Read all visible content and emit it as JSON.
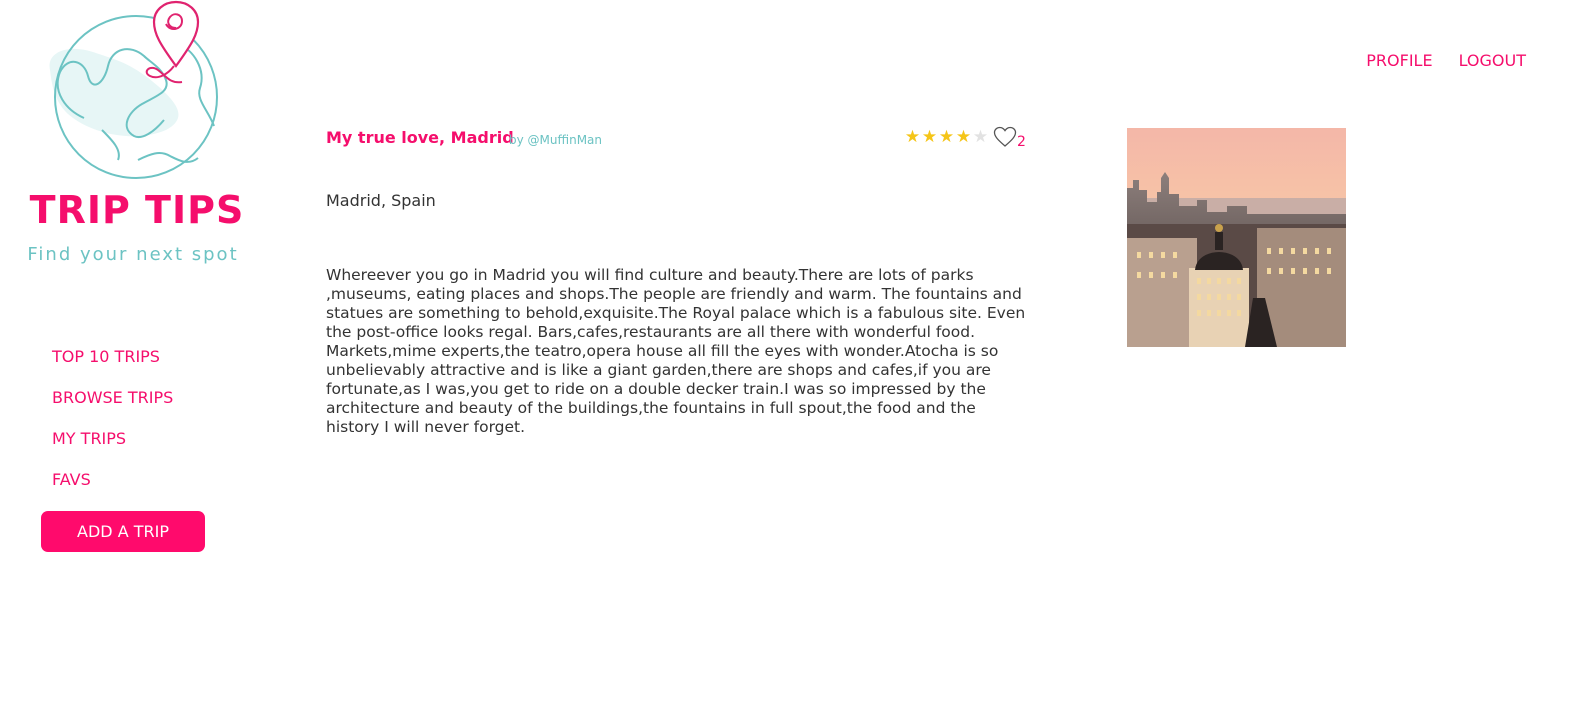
{
  "brand": {
    "name": "TRIP TIPS",
    "tagline": "Find your next spot",
    "logo_icon": "globe-with-location-pin-icon",
    "primary_color": "#f50e6c",
    "secondary_color": "#6cc3c3"
  },
  "header": {
    "nav": [
      {
        "label": "PROFILE"
      },
      {
        "label": "LOGOUT"
      }
    ]
  },
  "sidebar": {
    "items": [
      {
        "label": "TOP 10 TRIPS"
      },
      {
        "label": "BROWSE TRIPS"
      },
      {
        "label": "MY TRIPS"
      },
      {
        "label": "FAVS"
      }
    ],
    "add_button": "ADD A TRIP"
  },
  "trip": {
    "title": "My true love, Madrid",
    "author": "by @MuffinMan",
    "rating": 4,
    "rating_max": 5,
    "likes": "2",
    "location": "Madrid, Spain",
    "description": "Whereever you go in Madrid you will find culture and beauty.There are lots of parks ,museums, eating places and shops.The people are friendly and warm. The fountains and statues are something to behold,exquisite.The Royal palace which is a fabulous site. Even the post-office looks regal. Bars,cafes,restaurants are all there with wonderful food. Markets,mime experts,the teatro,opera house all fill the eyes with wonder.Atocha is so unbelievably attractive and is like a giant garden,there are shops and cafes,if you are fortunate,as I was,you get to ride on a double decker train.I was so impressed by the architecture and beauty of the buildings,the fountains in full spout,the food and the history I will never forget.",
    "photo_icon": "madrid-cityscape-photo"
  }
}
